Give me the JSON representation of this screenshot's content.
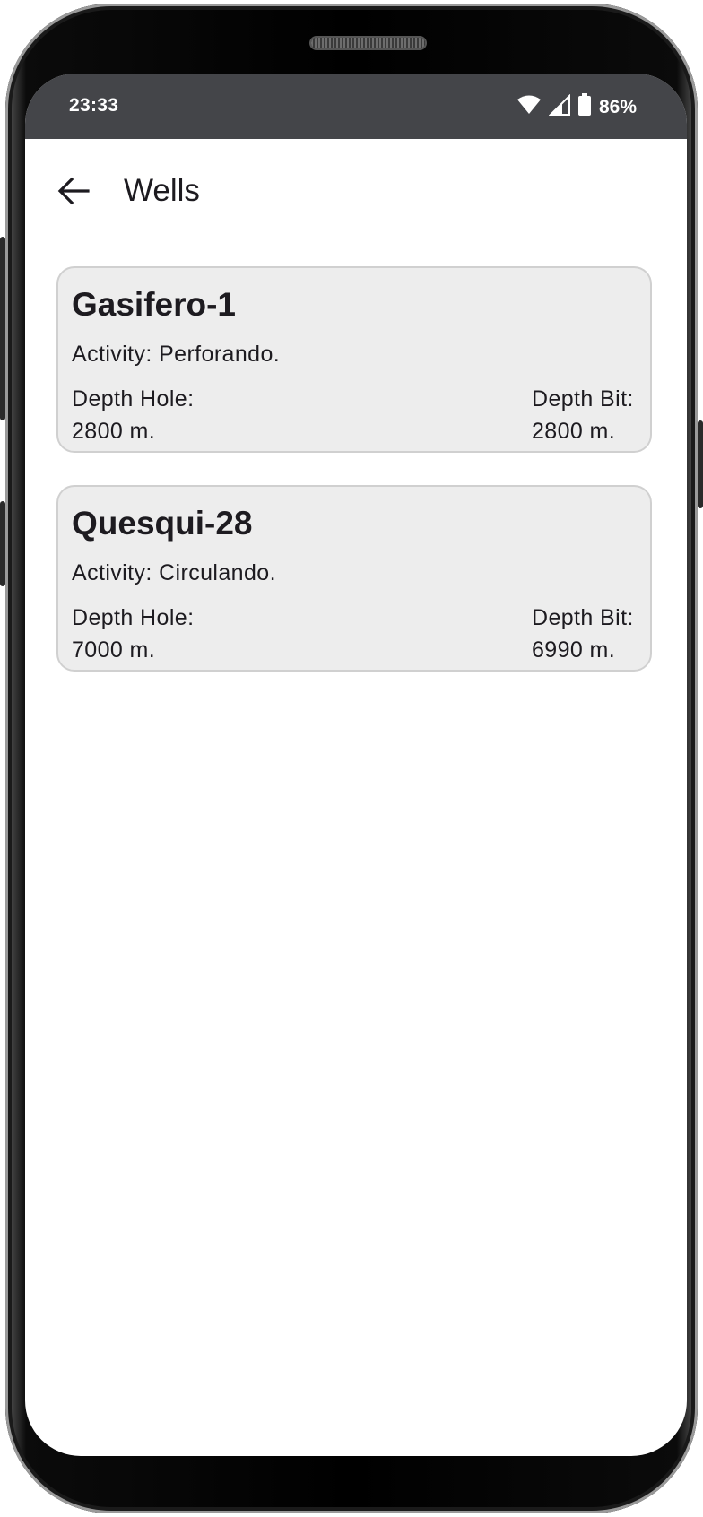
{
  "status_bar": {
    "time": "23:33",
    "battery": "86%",
    "icons": [
      "wifi-icon",
      "signal-icon",
      "battery-icon"
    ]
  },
  "app_bar": {
    "back_icon": "arrow-back-icon",
    "title": "Wells"
  },
  "wells": [
    {
      "name": "Gasifero-1",
      "activity": "Activity: Perforando.",
      "depth_hole_label": "Depth Hole:",
      "depth_hole_value": "2800 m.",
      "depth_bit_label": "Depth Bit:",
      "depth_bit_value": "2800 m."
    },
    {
      "name": "Quesqui-28",
      "activity": "Activity: Circulando.",
      "depth_hole_label": "Depth Hole:",
      "depth_hole_value": "7000 m.",
      "depth_bit_label": "Depth Bit:",
      "depth_bit_value": "6990 m."
    }
  ],
  "colors": {
    "status_bar": "#444549",
    "card_background": "#ededed",
    "card_border": "#d0d0d0",
    "text": "#1d1b20"
  }
}
